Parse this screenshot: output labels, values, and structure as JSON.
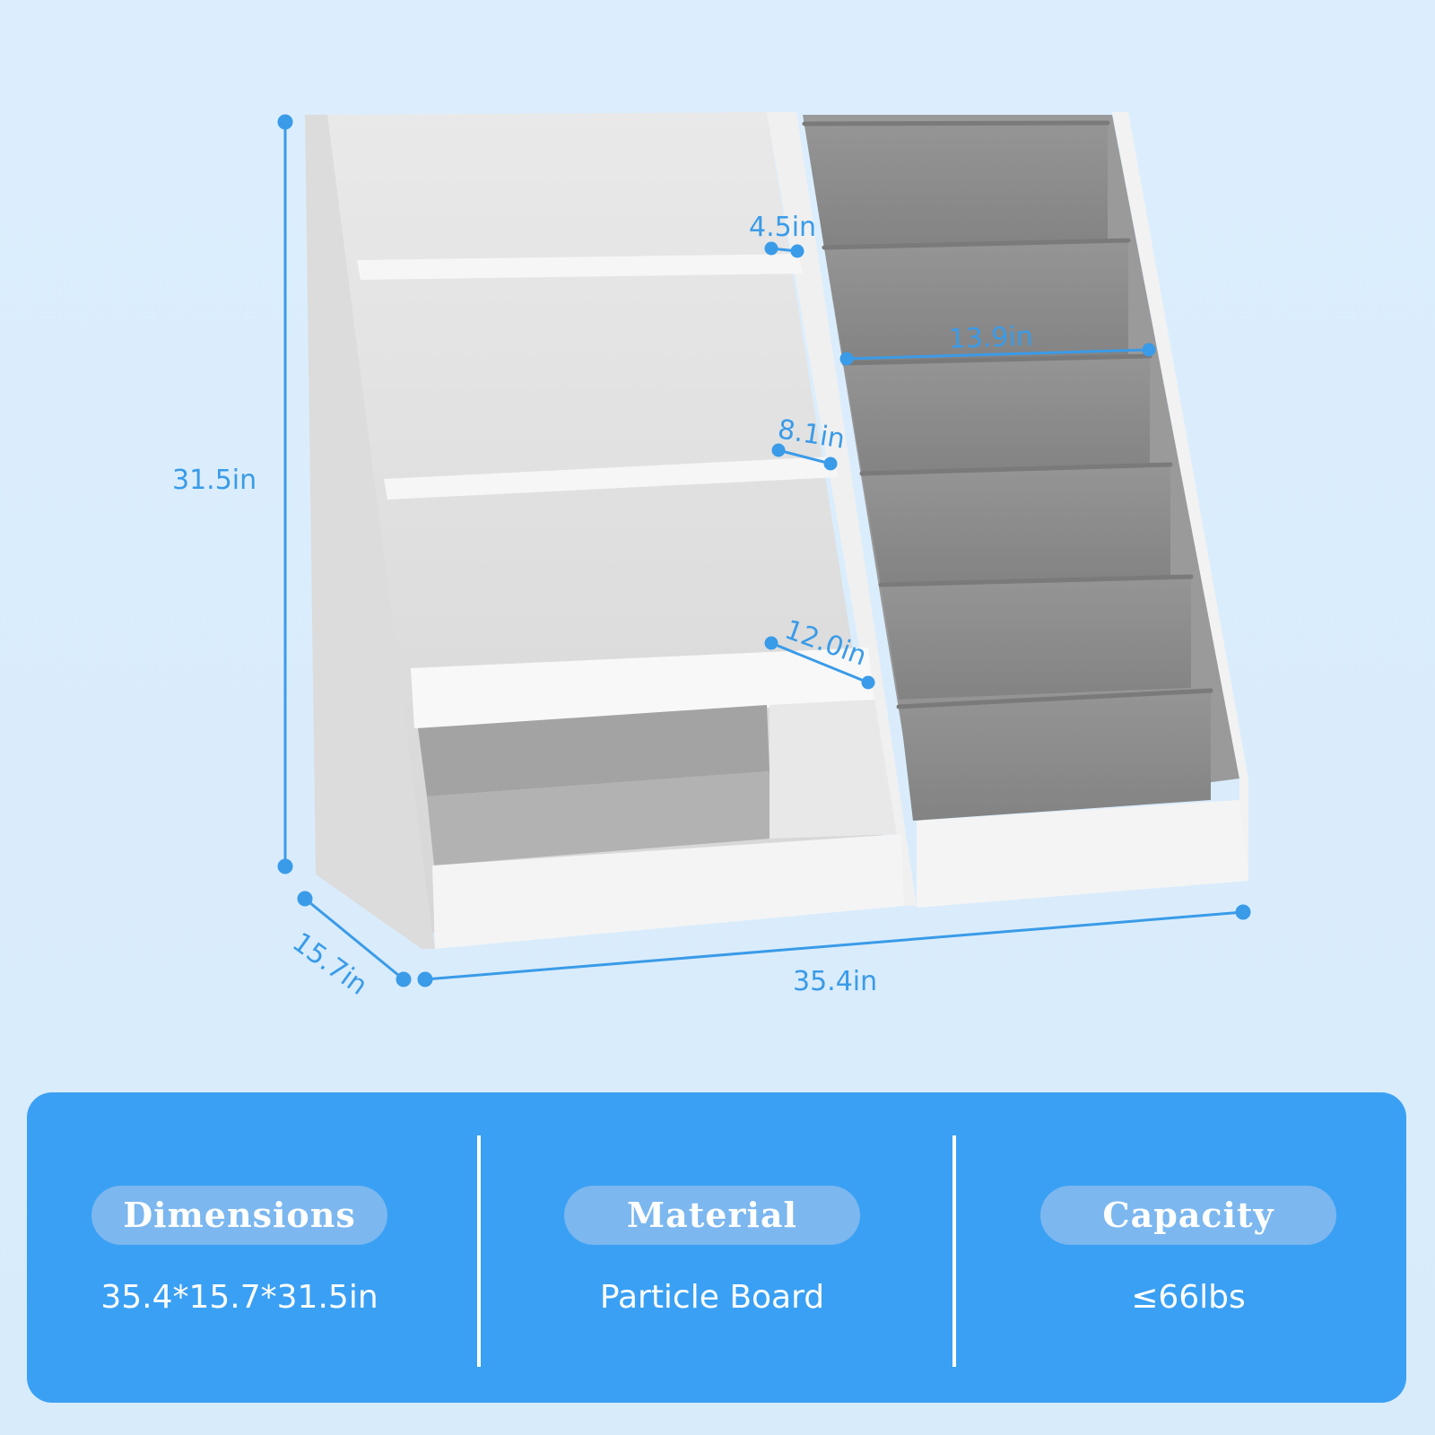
{
  "dimensions_labels": {
    "height": "31.5in",
    "depth": "15.7in",
    "width": "35.4in",
    "top_shelf_depth": "4.5in",
    "mid_shelf_depth": "8.1in",
    "low_shelf_depth": "12.0in",
    "sling_width": "13.9in"
  },
  "info": {
    "dimensions": {
      "title": "Dimensions",
      "value": "35.4*15.7*31.5in"
    },
    "material": {
      "title": "Material",
      "value": "Particle Board"
    },
    "capacity": {
      "title": "Capacity",
      "value": "≤66lbs"
    }
  },
  "colors": {
    "background": "#dcedfc",
    "accent": "#3aa0f4",
    "dimension_line": "#3a9be8",
    "pill": "#7cb7ef",
    "shelf_white": "#f4f4f4",
    "sling_gray": "#8c8c8c"
  },
  "icons": {
    "bookshelf": "bookshelf-illustration"
  }
}
